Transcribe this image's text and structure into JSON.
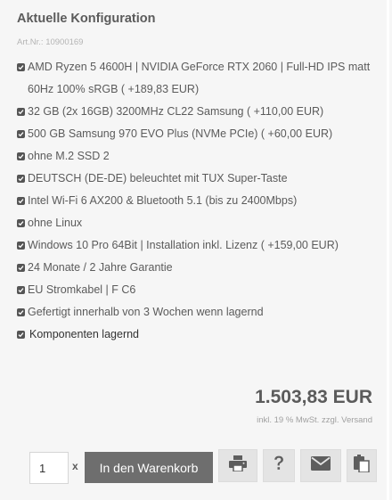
{
  "config": {
    "title": "Aktuelle Konfiguration",
    "art_nr": "Art.Nr.: 10900169",
    "items": [
      "AMD Ryzen 5 4600H | NVIDIA GeForce RTX 2060 | Full-HD IPS matt 60Hz 100% sRGB ( +189,83 EUR)",
      "32 GB (2x 16GB) 3200MHz CL22 Samsung ( +110,00 EUR)",
      "500 GB Samsung 970 EVO Plus (NVMe PCIe) ( +60,00 EUR)",
      "ohne M.2 SSD 2",
      "DEUTSCH (DE-DE) beleuchtet mit TUX Super-Taste",
      "Intel Wi-Fi 6 AX200 & Bluetooth 5.1 (bis zu 2400Mbps)",
      "ohne Linux",
      "Windows 10 Pro 64Bit | Installation inkl. Lizenz ( +159,00 EUR)",
      "24 Monate / 2 Jahre Garantie",
      "EU Stromkabel | F C6",
      "Gefertigt innerhalb von 3 Wochen wenn lagernd",
      "Komponenten lagernd"
    ]
  },
  "price": {
    "amount": "1.503,83 EUR",
    "vat_note": "inkl. 19 % MwSt. zzgl. Versand"
  },
  "buy": {
    "quantity": "1",
    "times": "x",
    "cart_label": "In den Warenkorb"
  },
  "actions": {
    "icons": [
      "print-icon",
      "question-icon",
      "envelope-icon",
      "clipboard-icon"
    ]
  }
}
